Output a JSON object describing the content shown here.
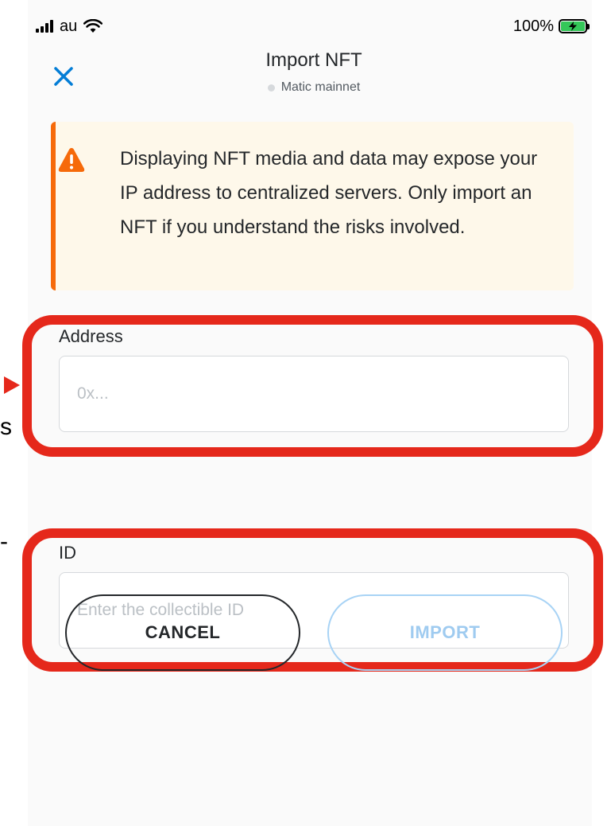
{
  "status_bar": {
    "carrier": "au",
    "battery": "100%"
  },
  "header": {
    "title": "Import NFT",
    "network": "Matic mainnet"
  },
  "warning": {
    "text": "Displaying NFT media and data may expose your IP address to centralized servers. Only import an NFT if you understand the risks involved."
  },
  "form": {
    "address": {
      "label": "Address",
      "placeholder": "0x..."
    },
    "id": {
      "label": "ID",
      "placeholder": "Enter the collectible ID"
    }
  },
  "actions": {
    "cancel": "CANCEL",
    "import": "IMPORT"
  },
  "edge_fragments": {
    "letter": "s",
    "mark": "-"
  },
  "colors": {
    "accent": "#037dd6",
    "warning": "#f66a0a",
    "annotation": "#e5281b",
    "battery": "#34c759"
  }
}
